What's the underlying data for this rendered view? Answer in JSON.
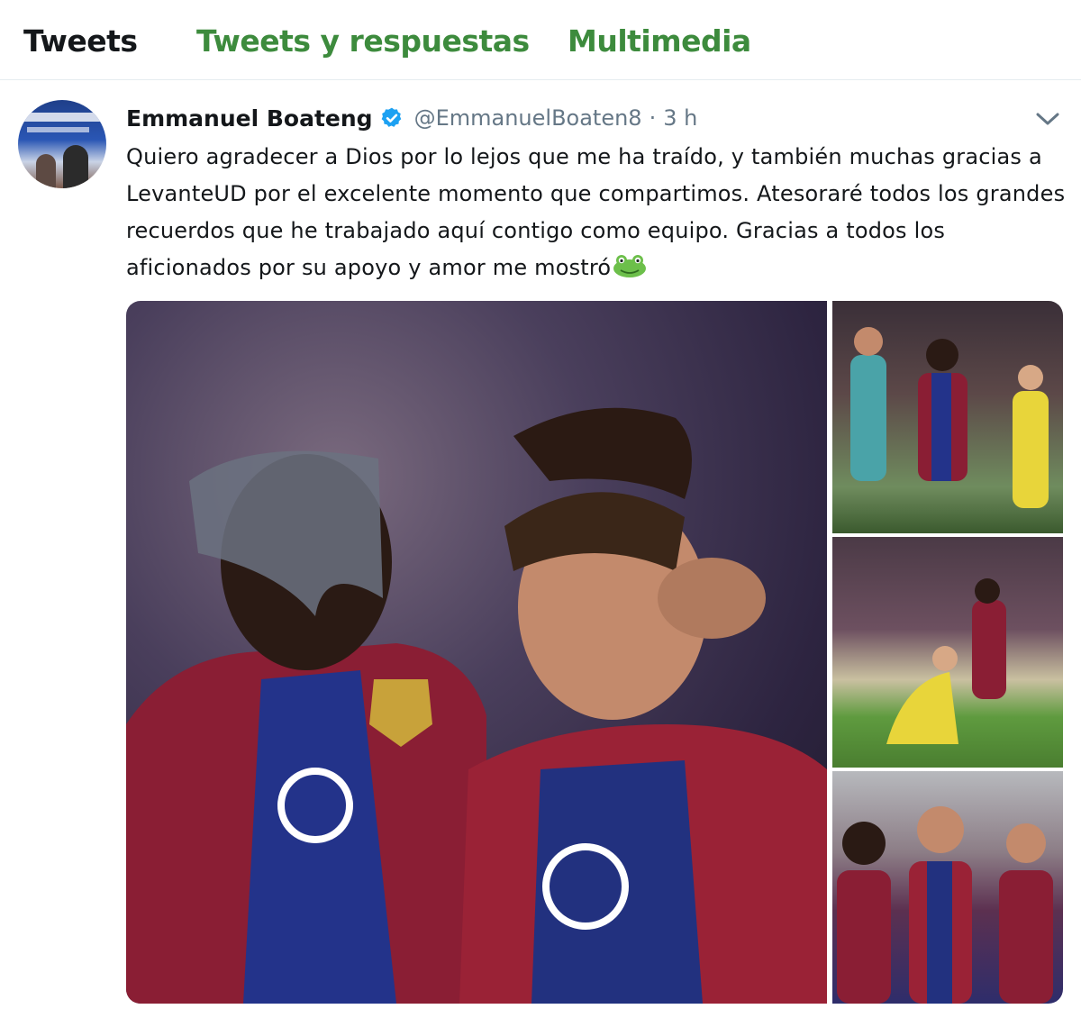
{
  "tabs": [
    {
      "label": "Tweets",
      "active": true
    },
    {
      "label": "Tweets y respuestas",
      "active": false
    },
    {
      "label": "Multimedia",
      "active": false
    }
  ],
  "colors": {
    "active_tab": "#14171a",
    "inactive_tab": "#3d8b3d",
    "verified_badge": "#1da1f2",
    "secondary_text": "#657786"
  },
  "tweet": {
    "author_name": "Emmanuel Boateng",
    "verified_icon": "verified-badge-icon",
    "handle": "@EmmanuelBoaten8",
    "separator": "·",
    "time": "3 h",
    "text": "Quiero agradecer a Dios por lo lejos que me ha traído, y también muchas gracias a LevanteUD por el excelente momento que compartimos. Atesoraré todos los grandes recuerdos que he trabajado aquí contigo como equipo. Gracias a todos los aficionados por su apoyo y amor me mostró",
    "emoji_icon": "frog-emoji-icon",
    "menu_icon": "chevron-down-icon"
  }
}
